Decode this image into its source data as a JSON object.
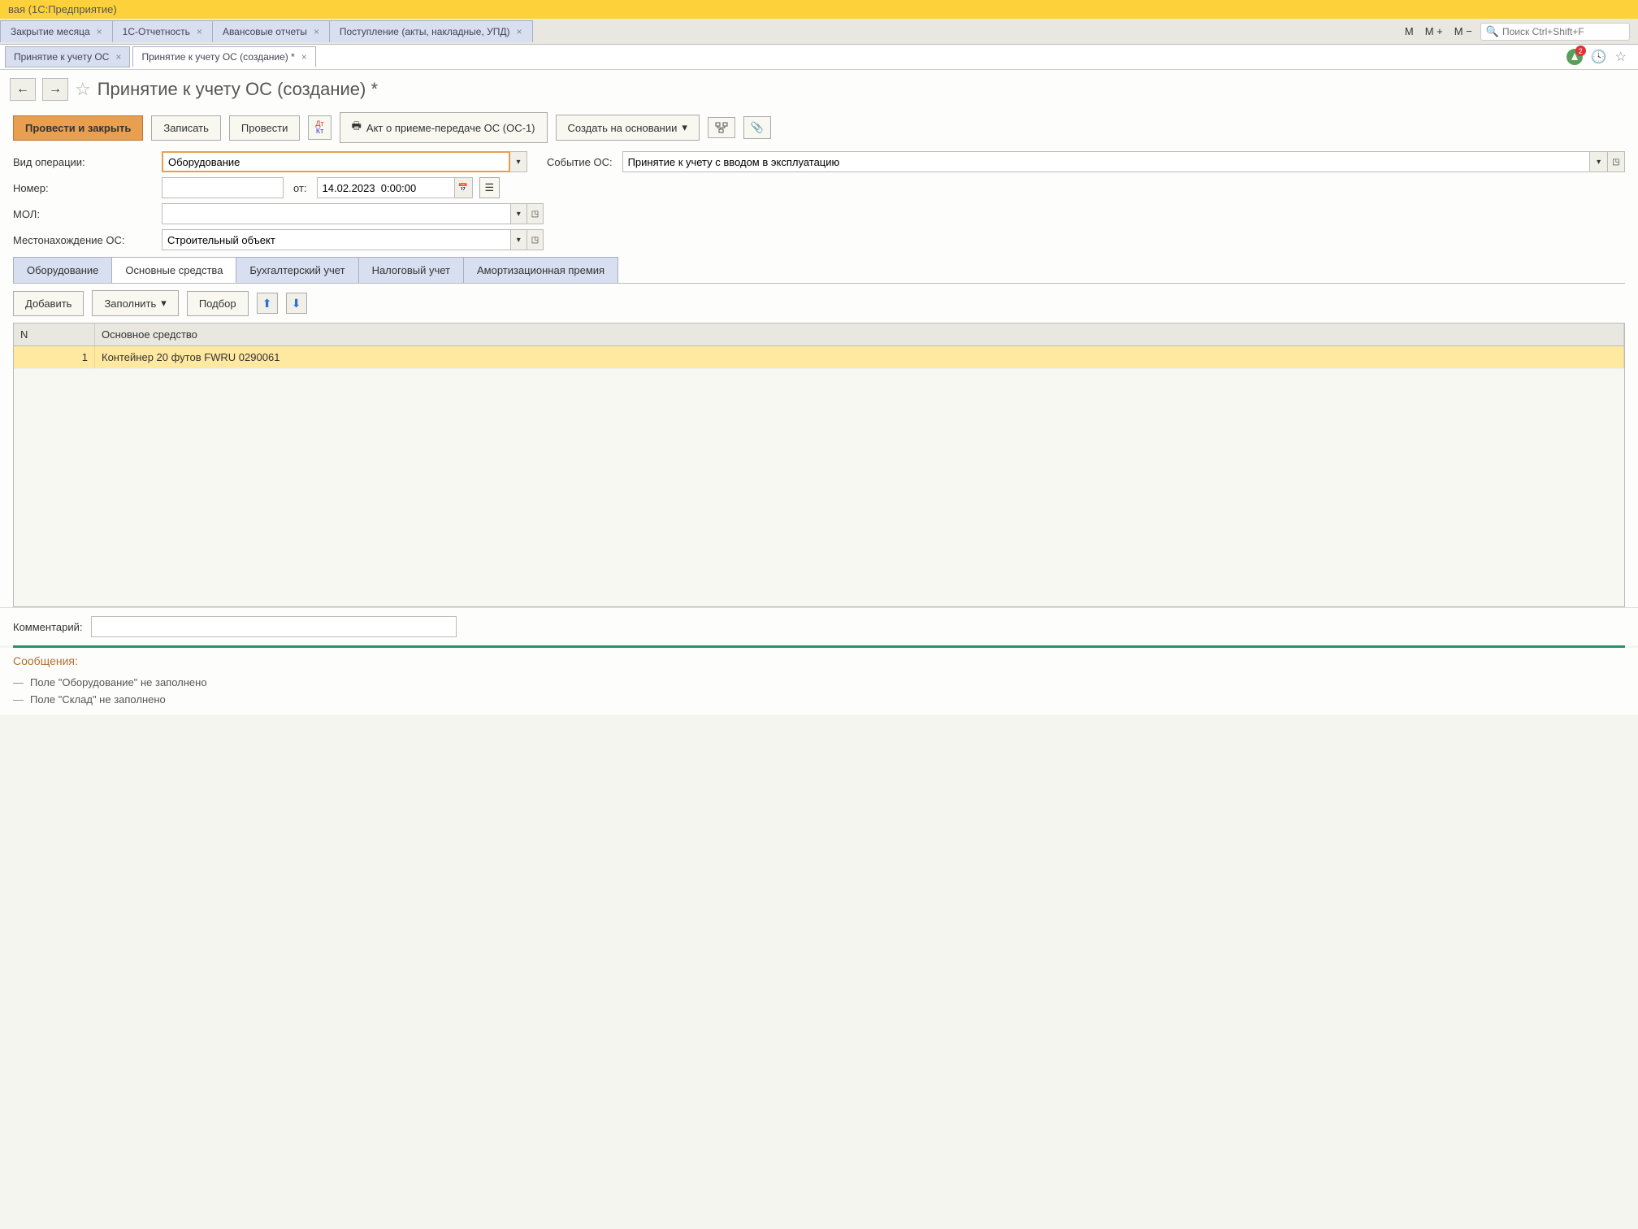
{
  "window_title": "вая  (1С:Предприятие)",
  "top_tabs": [
    {
      "label": "Закрытие месяца"
    },
    {
      "label": "1С-Отчетность"
    },
    {
      "label": "Авансовые отчеты"
    },
    {
      "label": "Поступление (акты, накладные, УПД)"
    },
    {
      "label": "Принятие к учету ОС"
    },
    {
      "label": "Принятие к учету ОС (создание) *"
    }
  ],
  "zoom": {
    "m": "M",
    "mplus": "M +",
    "mminus": "M −"
  },
  "search_placeholder": "Поиск Ctrl+Shift+F",
  "badge_count": "2",
  "page_title": "Принятие к учету ОС (создание) *",
  "toolbar": {
    "post_close": "Провести и закрыть",
    "save": "Записать",
    "post": "Провести",
    "act": "Акт о приеме-передаче ОС (ОС-1)",
    "create_based": "Создать на основании"
  },
  "fields": {
    "op_type_label": "Вид операции:",
    "op_type_value": "Оборудование",
    "event_label": "Событие ОС:",
    "event_value": "Принятие к учету с вводом в эксплуатацию",
    "number_label": "Номер:",
    "number_value": "",
    "date_label": "от:",
    "date_value": "14.02.2023  0:00:00",
    "mol_label": "МОЛ:",
    "mol_value": "",
    "location_label": "Местонахождение ОС:",
    "location_value": "Строительный объект"
  },
  "sub_tabs": [
    {
      "label": "Оборудование"
    },
    {
      "label": "Основные средства"
    },
    {
      "label": "Бухгалтерский учет"
    },
    {
      "label": "Налоговый учет"
    },
    {
      "label": "Амортизационная премия"
    }
  ],
  "sub_toolbar": {
    "add": "Добавить",
    "fill": "Заполнить",
    "pick": "Подбор"
  },
  "grid": {
    "col_n": "N",
    "col_asset": "Основное средство",
    "rows": [
      {
        "n": "1",
        "asset": "Контейнер 20 футов FWRU 0290061"
      }
    ]
  },
  "comment_label": "Комментарий:",
  "comment_value": "",
  "messages_title": "Сообщения:",
  "messages": [
    "Поле \"Оборудование\" не заполнено",
    "Поле \"Склад\" не заполнено"
  ]
}
